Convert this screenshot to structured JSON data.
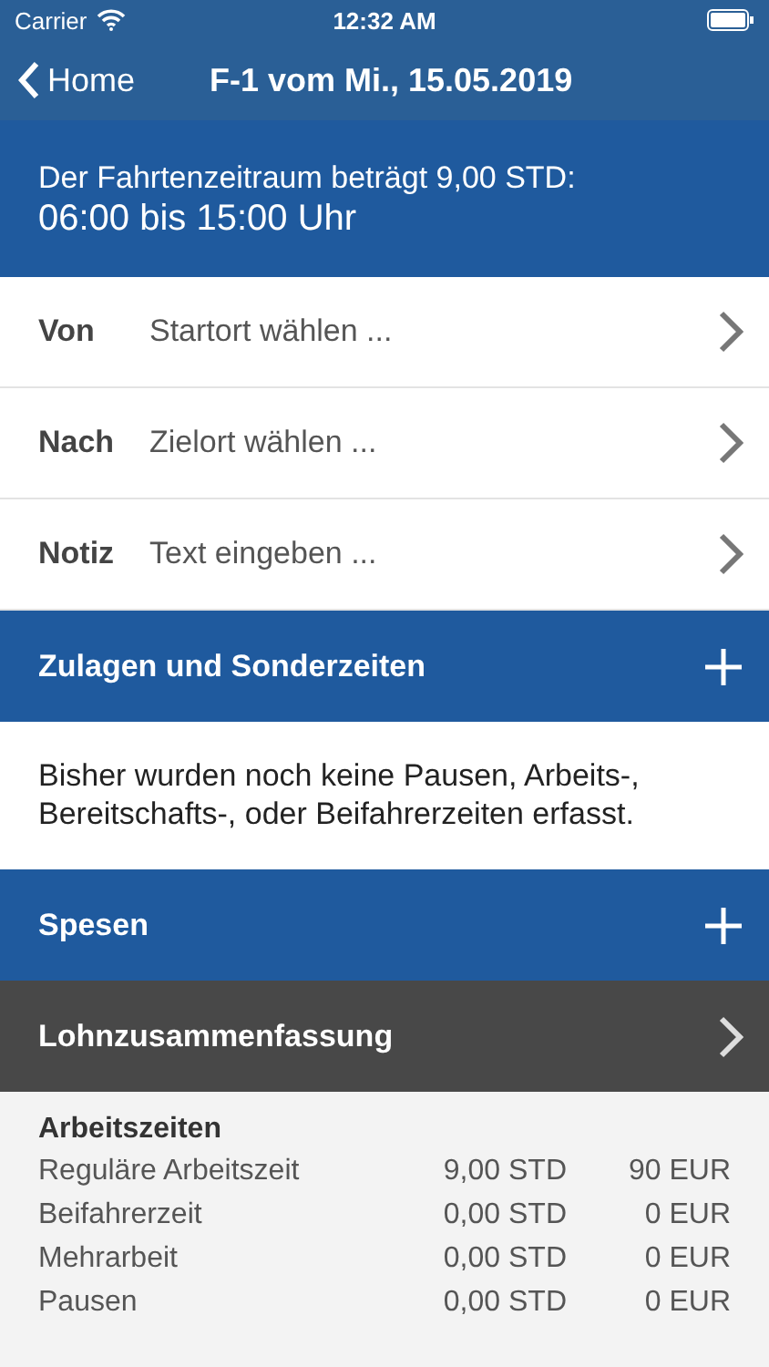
{
  "status_bar": {
    "carrier": "Carrier",
    "time": "12:32 AM"
  },
  "nav": {
    "back": "Home",
    "title": "F-1 vom Mi., 15.05.2019"
  },
  "summary": {
    "line_1": "Der Fahrtenzeitraum beträgt 9,00 STD:",
    "line_2": "06:00 bis 15:00 Uhr"
  },
  "fields": [
    {
      "label": "Von",
      "placeholder": "Startort wählen ..."
    },
    {
      "label": "Nach",
      "placeholder": "Zielort wählen ..."
    },
    {
      "label": "Notiz",
      "placeholder": "Text eingeben ..."
    }
  ],
  "sections": [
    {
      "kind": "add",
      "title": "Zulagen und Sonderzeiten",
      "note": "Bisher wurden noch keine Pausen, Arbeits-, Bereitschafts-, oder Beifahrerzeiten erfasst."
    },
    {
      "kind": "add",
      "title": "Spesen"
    },
    {
      "kind": "open",
      "title": "Lohnzusammenfassung"
    }
  ],
  "wage_summary": {
    "heading": "Arbeitszeiten",
    "rows": [
      {
        "label": "Reguläre Arbeitszeit",
        "hours": "9,00 STD",
        "amount": "90 EUR"
      },
      {
        "label": "Beifahrerzeit",
        "hours": "0,00 STD",
        "amount": "0 EUR"
      },
      {
        "label": "Mehrarbeit",
        "hours": "0,00 STD",
        "amount": "0 EUR"
      },
      {
        "label": "Pausen",
        "hours": "0,00 STD",
        "amount": "0 EUR"
      }
    ]
  }
}
